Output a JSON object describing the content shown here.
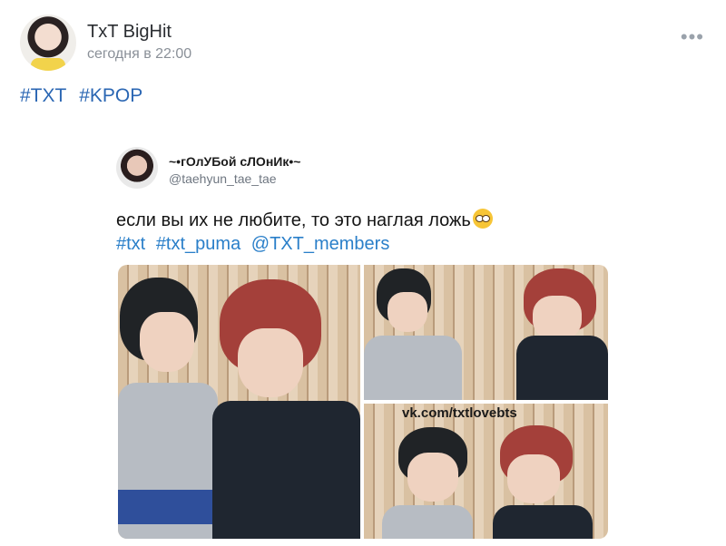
{
  "post": {
    "author": "TxT BigHit",
    "time": "сегодня в 22:00",
    "more_icon": "•••",
    "hashtags": [
      "#TXT",
      "#KPOP"
    ]
  },
  "tweet": {
    "display_name": "~•гОлУБой сЛОнИк•~",
    "handle": "@taehyun_tae_tae",
    "text": "если вы их не любите, то это наглая ложь",
    "emoji": "rolling-eyes-emoji",
    "tags": [
      "#txt",
      "#txt_puma",
      "@TXT_members"
    ],
    "watermark": "vk.com/txtlovebts"
  },
  "colors": {
    "link": "#2a66b3",
    "tweet_link": "#2a7fc9",
    "meta": "#8a9098"
  }
}
